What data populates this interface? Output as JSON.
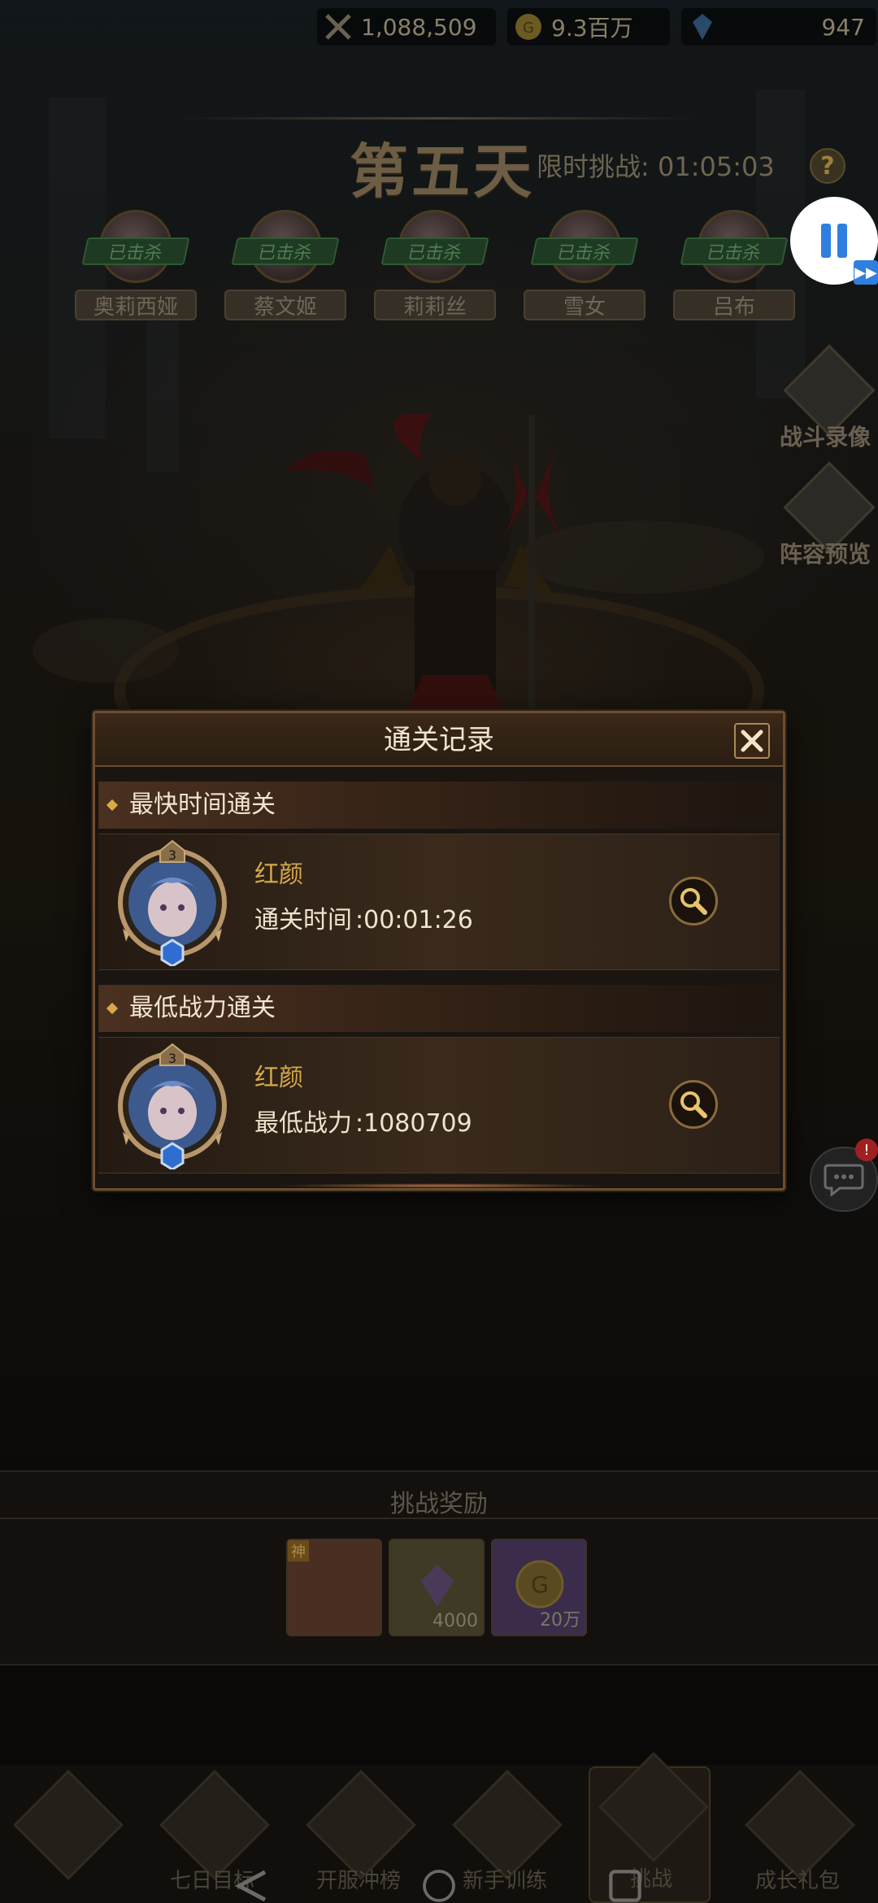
{
  "resources": {
    "power": "1,088,509",
    "gold": "9.3百万",
    "gems": "947"
  },
  "stage": {
    "title": "第五天",
    "timer_label": "限时挑战",
    "timer_value": "01:05:03",
    "help": "?"
  },
  "heroes": [
    {
      "name": "奥莉西娅",
      "status": "已击杀"
    },
    {
      "name": "蔡文姬",
      "status": "已击杀"
    },
    {
      "name": "莉莉丝",
      "status": "已击杀"
    },
    {
      "name": "雪女",
      "status": "已击杀"
    },
    {
      "name": "吕布",
      "status": "已击杀"
    }
  ],
  "side_buttons": {
    "battle_replay": "战斗录像",
    "lineup_preview": "阵容预览"
  },
  "chat": {
    "badge": "!"
  },
  "dialog": {
    "title": "通关记录",
    "fastest": {
      "section": "最快时间通关",
      "player": "红颜",
      "label": "通关时间",
      "value": ":00:01:26",
      "level": "3"
    },
    "lowest_power": {
      "section": "最低战力通关",
      "player": "红颜",
      "label": "最低战力",
      "value": ":1080709",
      "level": "3"
    }
  },
  "rewards": {
    "title": "挑战奖励",
    "items": [
      {
        "qty": "",
        "tag": "神"
      },
      {
        "qty": "4000",
        "tag": ""
      },
      {
        "qty": "20万",
        "tag": ""
      }
    ]
  },
  "bottom_nav": [
    {
      "label": ""
    },
    {
      "label": "七日目标"
    },
    {
      "label": "开服冲榜"
    },
    {
      "label": "新手训练"
    },
    {
      "label": "挑战"
    },
    {
      "label": "成长礼包"
    }
  ],
  "colors": {
    "accent_gold": "#d6a94a",
    "dialog_border": "#6b4e30",
    "pause_bg": "#ffffff",
    "pause_icon": "#2f7fe0"
  }
}
